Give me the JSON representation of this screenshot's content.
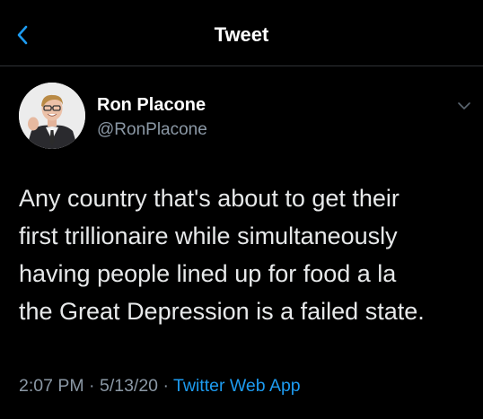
{
  "header": {
    "title": "Tweet"
  },
  "author": {
    "name": "Ron Placone",
    "handle": "@RonPlacone"
  },
  "tweet": {
    "lines": [
      "Any country that's about to get their",
      "first trillionaire while simultaneously",
      "having people lined up for food a la",
      "the Great Depression is a failed state."
    ],
    "time": "2:07 PM",
    "separator": "·",
    "date": "5/13/20",
    "source": "Twitter Web App"
  },
  "icons": {
    "back": "chevron-left-icon",
    "more": "chevron-down-icon"
  },
  "colors": {
    "background": "#000000",
    "text": "#e7e9ea",
    "muted": "#8b98a5",
    "accent": "#1d9bf0",
    "divider": "#2f3336"
  }
}
